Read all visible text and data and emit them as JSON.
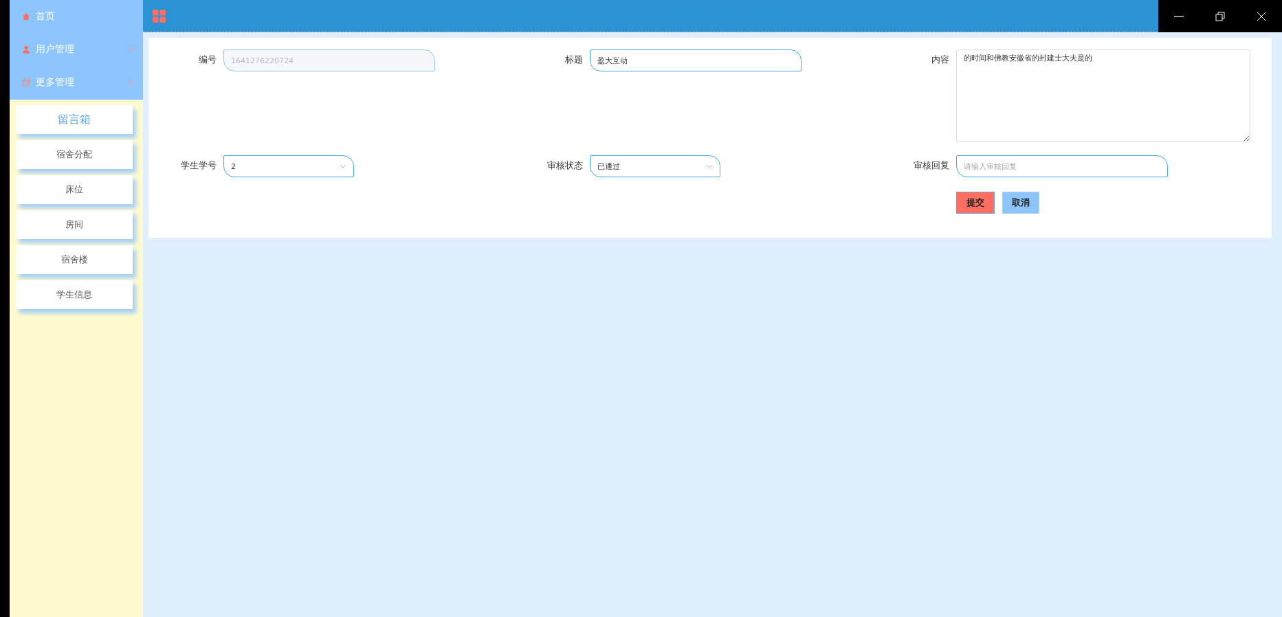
{
  "sidebar": {
    "items": [
      {
        "label": "首页",
        "kind": "link"
      },
      {
        "label": "用户管理",
        "kind": "group",
        "expanded": false
      },
      {
        "label": "更多管理",
        "kind": "group",
        "expanded": true,
        "children": [
          {
            "label": "留言箱",
            "selected": true
          },
          {
            "label": "宿舍分配",
            "selected": false
          },
          {
            "label": "床位",
            "selected": false
          },
          {
            "label": "房间",
            "selected": false
          },
          {
            "label": "宿舍楼",
            "selected": false
          },
          {
            "label": "学生信息",
            "selected": false
          }
        ]
      }
    ]
  },
  "form": {
    "fields": [
      {
        "label": "编号",
        "kind": "input",
        "value": "1641276220724",
        "disabled": true
      },
      {
        "label": "标题",
        "kind": "input",
        "value": "盈大互动",
        "disabled": false
      },
      {
        "label": "内容",
        "kind": "textarea",
        "value": "的时间和佛教安徽省的封建士大夫是的",
        "disabled": false
      },
      {
        "label": "学生学号",
        "kind": "select",
        "value": "2",
        "disabled": false
      },
      {
        "label": "审核状态",
        "kind": "select",
        "value": "已通过",
        "disabled": false
      },
      {
        "label": "审核回复",
        "kind": "input",
        "placeholder": "请输入审核回复",
        "disabled": false
      }
    ],
    "buttons": [
      {
        "label": "提交",
        "kind": "submit"
      },
      {
        "label": "取消",
        "kind": "cancel"
      }
    ]
  }
}
